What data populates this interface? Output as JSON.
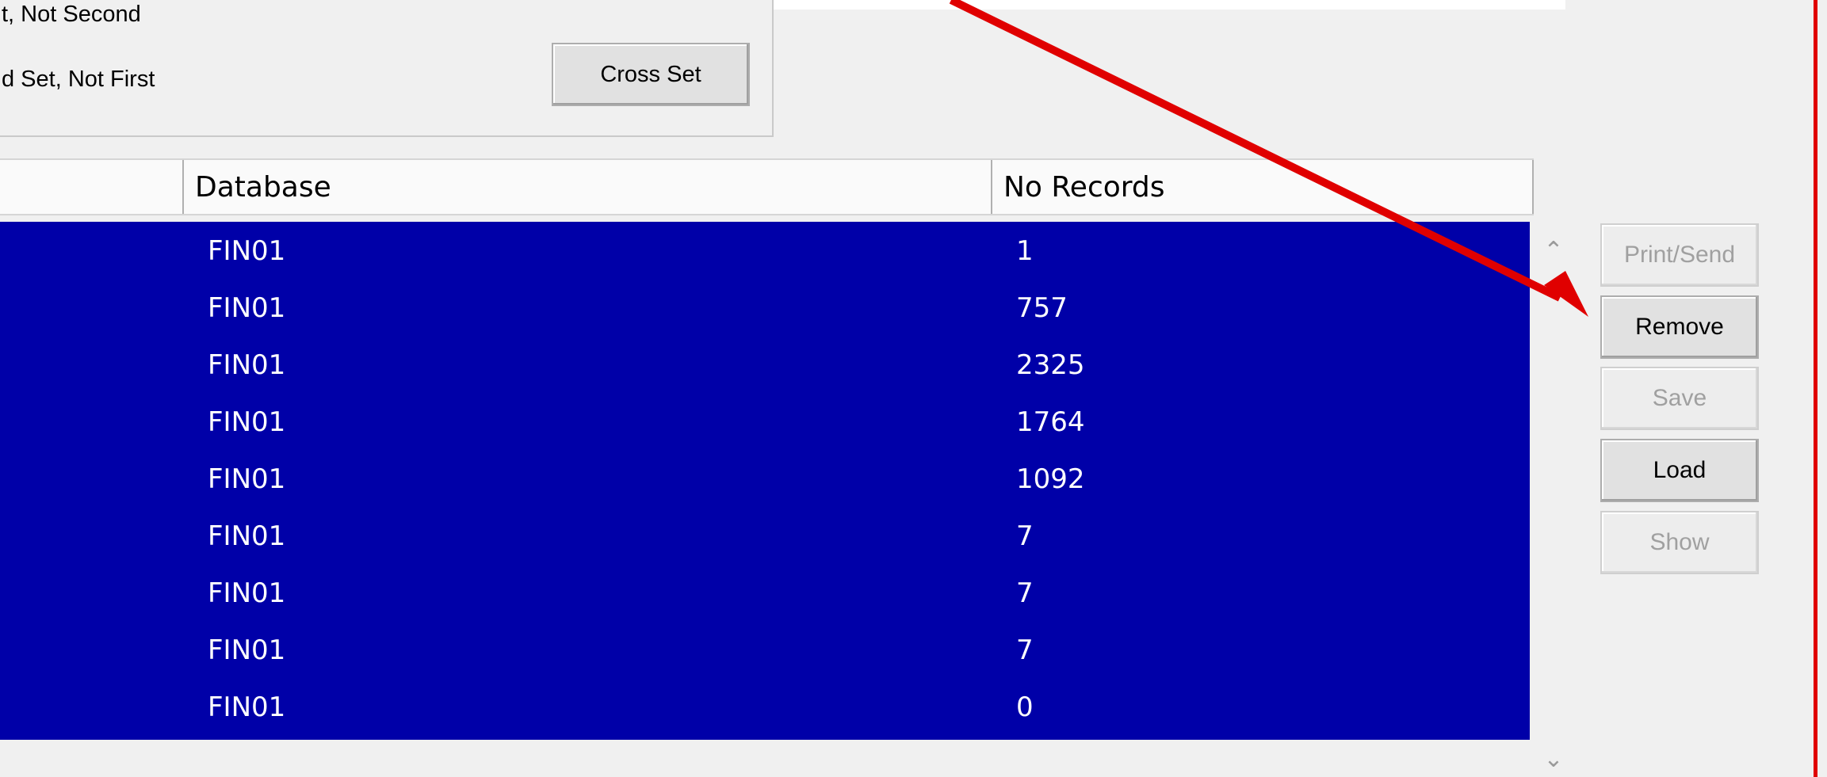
{
  "operations": {
    "option_first_not_second": "t, Not Second",
    "option_second_not_first": "d Set, Not First",
    "cross_set_label": "Cross Set"
  },
  "table": {
    "columns": [
      "",
      "Database",
      "No Records"
    ],
    "rows": [
      {
        "database": "FIN01",
        "records": "1"
      },
      {
        "database": "FIN01",
        "records": "757"
      },
      {
        "database": "FIN01",
        "records": "2325"
      },
      {
        "database": "FIN01",
        "records": "1764"
      },
      {
        "database": "FIN01",
        "records": "1092"
      },
      {
        "database": "FIN01",
        "records": "7"
      },
      {
        "database": "FIN01",
        "records": "7"
      },
      {
        "database": "FIN01",
        "records": "7"
      },
      {
        "database": "FIN01",
        "records": "0"
      }
    ]
  },
  "buttons": {
    "print_send": "Print/Send",
    "remove": "Remove",
    "save": "Save",
    "load": "Load",
    "show": "Show"
  },
  "colors": {
    "selection": "#0000a8",
    "annotation_arrow": "#e00000"
  },
  "icons": {
    "scroll_up": "chevron-up-icon",
    "scroll_down": "chevron-down-icon"
  }
}
